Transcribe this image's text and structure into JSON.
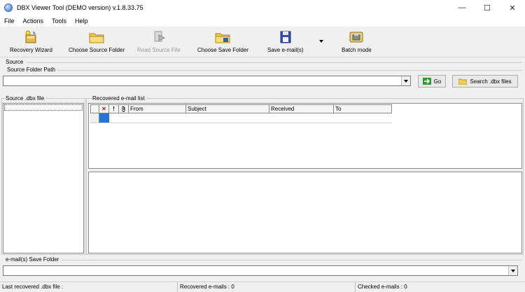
{
  "window": {
    "title": "DBX Viewer Tool (DEMO version) v.1.8.33.75",
    "minimize": "—",
    "maximize": "☐",
    "close": "✕"
  },
  "menu": [
    "File",
    "Actions",
    "Tools",
    "Help"
  ],
  "toolbar": {
    "recovery_wizard": "Recovery Wizard",
    "choose_source_folder": "Choose Source Folder",
    "read_source_file": "Read Source File",
    "choose_save_folder": "Choose Save Folder",
    "save_emails": "Save e-mail(s)",
    "batch_mode": "Batch mode"
  },
  "source": {
    "group_label": "Source",
    "folder_path_label": "Source Folder Path",
    "folder_path_value": "",
    "go_button": "Go",
    "search_button": "Search .dbx files"
  },
  "left_panel": {
    "label": "Source .dbx file"
  },
  "email_list": {
    "label": "Recovered e-mail list",
    "columns": [
      "",
      "✕",
      "!",
      "",
      "From",
      "Subject",
      "Received",
      "To"
    ]
  },
  "save_folder": {
    "label": "e-mail(s) Save Folder",
    "value": ""
  },
  "status": {
    "last_recovered": "Last recovered .dbx file :",
    "recovered_count": "Recovered e-mails : 0",
    "checked_count": "Checked e-mails : 0"
  },
  "colors": {
    "selection": "#1e78d7",
    "delete_red": "#d01010",
    "go_green": "#2e9a2e"
  }
}
